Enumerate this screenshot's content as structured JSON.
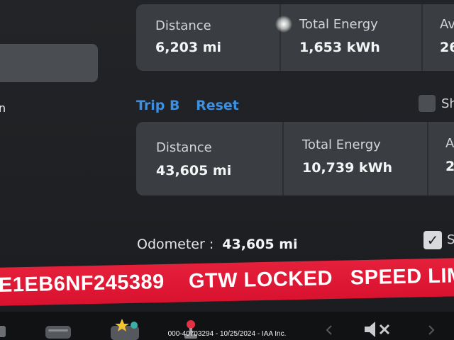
{
  "left": {
    "partial_text": "n"
  },
  "trip_a": {
    "distance_label": "Distance",
    "distance_value": "6,203 mi",
    "energy_label": "Total Energy",
    "energy_value": "1,653 kWh",
    "third_label": "Av",
    "third_value": "26"
  },
  "trip_b": {
    "title": "Trip B",
    "reset_label": "Reset",
    "distance_label": "Distance",
    "distance_value": "43,605 mi",
    "energy_label": "Total Energy",
    "energy_value": "10,739 kWh",
    "third_label": "A",
    "third_value": "2"
  },
  "show_toggle_label": "Sh",
  "odometer": {
    "label": "Odometer :",
    "value": "43,605 mi"
  },
  "odometer_check_label": "S",
  "banner": {
    "vin_text": "E1EB6NF245389",
    "lock_text": "GTW LOCKED",
    "speed_text": "SPEED LIM",
    "color": "#e01c36"
  },
  "watermark": "000-40703294 - 10/25/2024 - IAA Inc.",
  "dock_icons": [
    "app-icon",
    "toybox-icon",
    "joystick-icon",
    "mute-speaker-icon",
    "chevron-left-icon",
    "chevron-right-icon"
  ]
}
